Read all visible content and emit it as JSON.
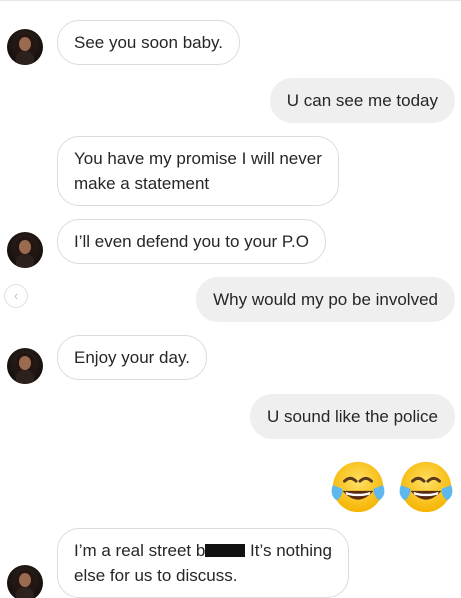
{
  "messages": [
    {
      "from": "them",
      "text": "See you soon baby."
    },
    {
      "from": "me",
      "text": "U can see me today"
    },
    {
      "from": "them",
      "lines": [
        "You have my promise I will never",
        "make a statement"
      ]
    },
    {
      "from": "them",
      "text": "I’ll even defend you to your P.O"
    },
    {
      "from": "me",
      "text": "Why would my po be involved"
    },
    {
      "from": "them",
      "text": "Enjoy your day."
    },
    {
      "from": "me",
      "text": "U sound like the police"
    },
    {
      "from": "me",
      "emoji": [
        "😂",
        "😂"
      ],
      "icon": "face-with-tears-of-joy-icon"
    },
    {
      "from": "them",
      "lines_parts": {
        "line1_before": "I’m a real street b",
        "line1_after": " It’s nothing",
        "line2": "else for us to discuss."
      }
    }
  ],
  "colors": {
    "incoming_border": "#dbdbdb",
    "outgoing_bg": "#efefef",
    "text": "#262626"
  }
}
